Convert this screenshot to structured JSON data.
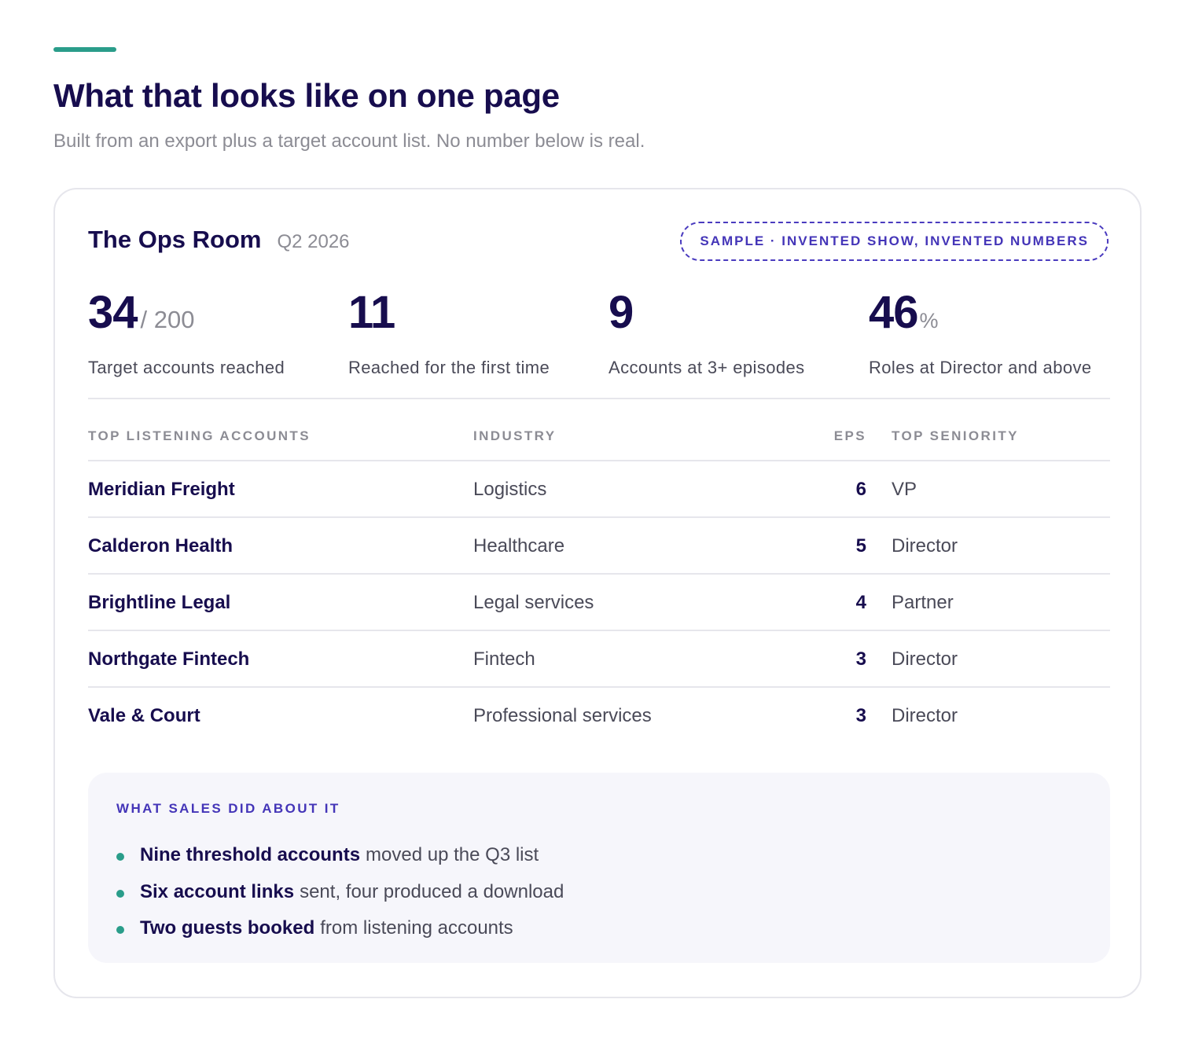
{
  "header": {
    "title": "What that looks like on one page",
    "subtitle": "Built from an export plus a target account list. No number below is real."
  },
  "card": {
    "show_name": "The Ops Room",
    "period": "Q2 2026",
    "badge": "SAMPLE · INVENTED SHOW, INVENTED NUMBERS"
  },
  "stats": [
    {
      "value": "34",
      "suffix": "/ 200",
      "label": "Target accounts reached"
    },
    {
      "value": "11",
      "suffix": "",
      "label": "Reached for the first time"
    },
    {
      "value": "9",
      "suffix": "",
      "label": "Accounts at 3+ episodes"
    },
    {
      "value": "46",
      "suffix": "%",
      "label": "Roles at Director and above"
    }
  ],
  "table": {
    "headers": {
      "account": "TOP LISTENING ACCOUNTS",
      "industry": "INDUSTRY",
      "eps": "EPS",
      "seniority": "TOP SENIORITY"
    },
    "rows": [
      {
        "account": "Meridian Freight",
        "industry": "Logistics",
        "eps": "6",
        "seniority": "VP"
      },
      {
        "account": "Calderon Health",
        "industry": "Healthcare",
        "eps": "5",
        "seniority": "Director"
      },
      {
        "account": "Brightline Legal",
        "industry": "Legal services",
        "eps": "4",
        "seniority": "Partner"
      },
      {
        "account": "Northgate Fintech",
        "industry": "Fintech",
        "eps": "3",
        "seniority": "Director"
      },
      {
        "account": "Vale & Court",
        "industry": "Professional services",
        "eps": "3",
        "seniority": "Director"
      }
    ]
  },
  "sales": {
    "title": "WHAT SALES DID ABOUT IT",
    "items": [
      {
        "strong": "Nine threshold accounts",
        "rest": "moved up the Q3 list"
      },
      {
        "strong": "Six account links",
        "rest": "sent, four produced a download"
      },
      {
        "strong": "Two guests booked",
        "rest": "from listening accounts"
      }
    ]
  },
  "colors": {
    "accent_teal": "#2a9d8a",
    "brand_navy": "#170d4e",
    "badge_purple": "#4435b8",
    "muted_text": "#8c8c94"
  }
}
